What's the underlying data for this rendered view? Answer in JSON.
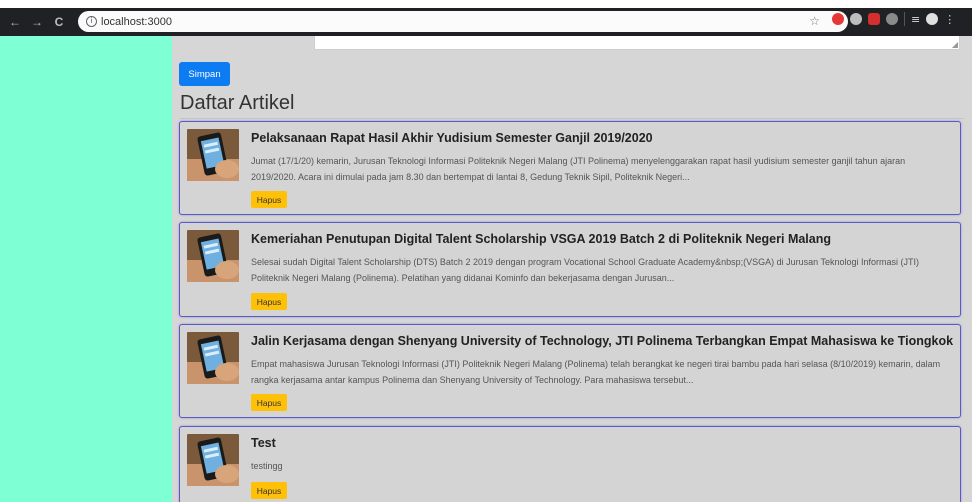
{
  "browser": {
    "url": "localhost:3000",
    "icons": [
      "back-icon",
      "forward-icon",
      "reload-icon",
      "site-info-icon",
      "bookmark-star-icon"
    ]
  },
  "form": {
    "save_label": "Simpan"
  },
  "section": {
    "title": "Daftar Artikel"
  },
  "articles": [
    {
      "title": "Pelaksanaan Rapat Hasil Akhir Yudisium Semester Ganjil 2019/2020",
      "summary": "Jumat (17/1/20) kemarin, Jurusan Teknologi Informasi Politeknik Negeri Malang (JTI Polinema) menyelenggarakan rapat hasil yudisium semester ganjil tahun ajaran 2019/2020. Acara ini dimulai pada jam 8.30 dan bertempat di lantai 8, Gedung Teknik Sipil, Politeknik Negeri...",
      "delete_label": "Hapus"
    },
    {
      "title": "Kemeriahan Penutupan Digital Talent Scholarship VSGA 2019 Batch 2 di Politeknik Negeri Malang",
      "summary": "Selesai sudah Digital Talent Scholarship (DTS) Batch 2 2019 dengan program Vocational School Graduate Academy&nbsp;(VSGA) di Jurusan Teknologi Informasi (JTI) Politeknik Negeri Malang (Polinema). Pelatihan yang didanai Kominfo dan bekerjasama dengan Jurusan...",
      "delete_label": "Hapus"
    },
    {
      "title": "Jalin Kerjasama dengan Shenyang University of Technology, JTI Polinema Terbangkan Empat Mahasiswa ke Tiongkok",
      "summary": "Empat mahasiswa Jurusan Teknologi Informasi (JTI) Politeknik Negeri Malang (Polinema) telah berangkat ke negeri tirai bambu pada hari selasa (8/10/2019) kemarin, dalam rangka kerjasama antar kampus Polinema dan Shenyang University of Technology. Para mahasiswa tersebut...",
      "delete_label": "Hapus"
    },
    {
      "title": "Test",
      "summary": "testingg",
      "delete_label": "Hapus"
    }
  ],
  "colors": {
    "sidebar": "#7fffd4",
    "primary": "#0d7cf2",
    "warning": "#ffc107",
    "card_border": "#5a59c8"
  }
}
